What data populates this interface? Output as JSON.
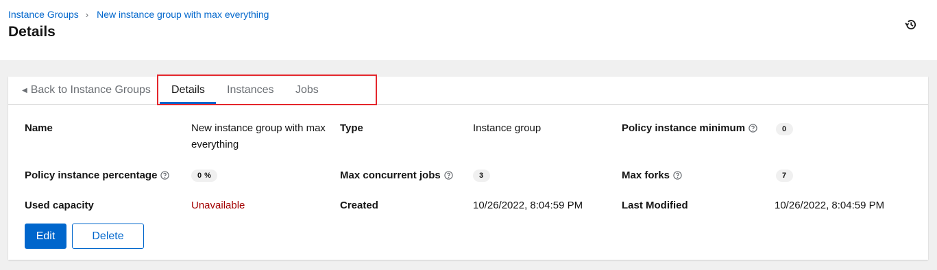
{
  "breadcrumb": {
    "items": [
      "Instance Groups",
      "New instance group with max everything"
    ],
    "separator": "›"
  },
  "page_title": "Details",
  "tabs": {
    "back": "Back to Instance Groups",
    "items": [
      "Details",
      "Instances",
      "Jobs"
    ],
    "active": "Details"
  },
  "details": {
    "name_label": "Name",
    "name_value": "New instance group with max everything",
    "type_label": "Type",
    "type_value": "Instance group",
    "policy_min_label": "Policy instance minimum",
    "policy_min_value": "0",
    "policy_pct_label": "Policy instance percentage",
    "policy_pct_value": "0 %",
    "max_jobs_label": "Max concurrent jobs",
    "max_jobs_value": "3",
    "max_forks_label": "Max forks",
    "max_forks_value": "7",
    "used_capacity_label": "Used capacity",
    "used_capacity_value": "Unavailable",
    "created_label": "Created",
    "created_value": "10/26/2022, 8:04:59 PM",
    "modified_label": "Last Modified",
    "modified_value": "10/26/2022, 8:04:59 PM"
  },
  "actions": {
    "edit": "Edit",
    "delete": "Delete"
  },
  "icons": {
    "history": "history-icon",
    "help": "question-circle-icon",
    "back": "caret-left-icon"
  },
  "colors": {
    "link": "#0066cc",
    "primary": "#0066cc",
    "error": "#a30000",
    "highlight": "#e4262c",
    "background": "#f0f0f0"
  }
}
